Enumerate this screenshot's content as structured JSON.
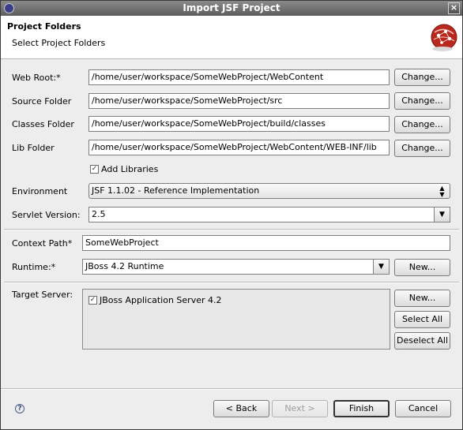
{
  "window": {
    "title": "Import JSF Project"
  },
  "banner": {
    "title": "Project Folders",
    "subtitle": "Select Project Folders"
  },
  "folders": [
    {
      "label": "Web Root:*",
      "value": "/home/user/workspace/SomeWebProject/WebContent",
      "button": "Change..."
    },
    {
      "label": "Source Folder",
      "value": "/home/user/workspace/SomeWebProject/src",
      "button": "Change..."
    },
    {
      "label": "Classes Folder",
      "value": "/home/user/workspace/SomeWebProject/build/classes",
      "button": "Change..."
    },
    {
      "label": "Lib Folder",
      "value": "/home/user/workspace/SomeWebProject/WebContent/WEB-INF/lib",
      "button": "Change..."
    }
  ],
  "add_libraries": {
    "label": "Add Libraries",
    "checked": true
  },
  "environment": {
    "label": "Environment",
    "value": "JSF 1.1.02 - Reference Implementation"
  },
  "servlet_version": {
    "label": "Servlet Version:",
    "value": "2.5"
  },
  "context_path": {
    "label": "Context Path*",
    "value": "SomeWebProject"
  },
  "runtime": {
    "label": "Runtime:*",
    "value": "JBoss 4.2 Runtime",
    "button": "New..."
  },
  "target_server": {
    "label": "Target Server:",
    "items": [
      {
        "label": "JBoss Application Server 4.2",
        "checked": true
      }
    ],
    "buttons": {
      "new": "New...",
      "select_all": "Select All",
      "deselect_all": "Deselect All"
    }
  },
  "footer": {
    "back": "< Back",
    "next": "Next >",
    "finish": "Finish",
    "cancel": "Cancel"
  },
  "icons": {
    "app": "eclipse-icon",
    "close": "close-icon",
    "help": "help-icon",
    "banner": "jsf-wizard-logo"
  }
}
